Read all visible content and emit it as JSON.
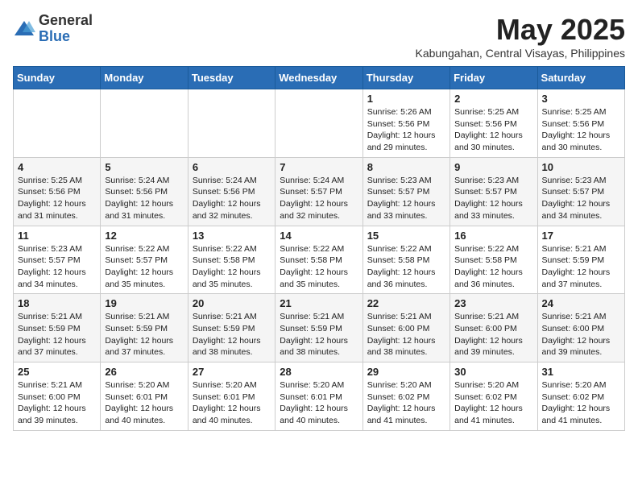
{
  "header": {
    "logo_general": "General",
    "logo_blue": "Blue",
    "month_title": "May 2025",
    "location": "Kabungahan, Central Visayas, Philippines"
  },
  "weekdays": [
    "Sunday",
    "Monday",
    "Tuesday",
    "Wednesday",
    "Thursday",
    "Friday",
    "Saturday"
  ],
  "weeks": [
    [
      {
        "day": "",
        "info": ""
      },
      {
        "day": "",
        "info": ""
      },
      {
        "day": "",
        "info": ""
      },
      {
        "day": "",
        "info": ""
      },
      {
        "day": "1",
        "info": "Sunrise: 5:26 AM\nSunset: 5:56 PM\nDaylight: 12 hours\nand 29 minutes."
      },
      {
        "day": "2",
        "info": "Sunrise: 5:25 AM\nSunset: 5:56 PM\nDaylight: 12 hours\nand 30 minutes."
      },
      {
        "day": "3",
        "info": "Sunrise: 5:25 AM\nSunset: 5:56 PM\nDaylight: 12 hours\nand 30 minutes."
      }
    ],
    [
      {
        "day": "4",
        "info": "Sunrise: 5:25 AM\nSunset: 5:56 PM\nDaylight: 12 hours\nand 31 minutes."
      },
      {
        "day": "5",
        "info": "Sunrise: 5:24 AM\nSunset: 5:56 PM\nDaylight: 12 hours\nand 31 minutes."
      },
      {
        "day": "6",
        "info": "Sunrise: 5:24 AM\nSunset: 5:56 PM\nDaylight: 12 hours\nand 32 minutes."
      },
      {
        "day": "7",
        "info": "Sunrise: 5:24 AM\nSunset: 5:57 PM\nDaylight: 12 hours\nand 32 minutes."
      },
      {
        "day": "8",
        "info": "Sunrise: 5:23 AM\nSunset: 5:57 PM\nDaylight: 12 hours\nand 33 minutes."
      },
      {
        "day": "9",
        "info": "Sunrise: 5:23 AM\nSunset: 5:57 PM\nDaylight: 12 hours\nand 33 minutes."
      },
      {
        "day": "10",
        "info": "Sunrise: 5:23 AM\nSunset: 5:57 PM\nDaylight: 12 hours\nand 34 minutes."
      }
    ],
    [
      {
        "day": "11",
        "info": "Sunrise: 5:23 AM\nSunset: 5:57 PM\nDaylight: 12 hours\nand 34 minutes."
      },
      {
        "day": "12",
        "info": "Sunrise: 5:22 AM\nSunset: 5:57 PM\nDaylight: 12 hours\nand 35 minutes."
      },
      {
        "day": "13",
        "info": "Sunrise: 5:22 AM\nSunset: 5:58 PM\nDaylight: 12 hours\nand 35 minutes."
      },
      {
        "day": "14",
        "info": "Sunrise: 5:22 AM\nSunset: 5:58 PM\nDaylight: 12 hours\nand 35 minutes."
      },
      {
        "day": "15",
        "info": "Sunrise: 5:22 AM\nSunset: 5:58 PM\nDaylight: 12 hours\nand 36 minutes."
      },
      {
        "day": "16",
        "info": "Sunrise: 5:22 AM\nSunset: 5:58 PM\nDaylight: 12 hours\nand 36 minutes."
      },
      {
        "day": "17",
        "info": "Sunrise: 5:21 AM\nSunset: 5:59 PM\nDaylight: 12 hours\nand 37 minutes."
      }
    ],
    [
      {
        "day": "18",
        "info": "Sunrise: 5:21 AM\nSunset: 5:59 PM\nDaylight: 12 hours\nand 37 minutes."
      },
      {
        "day": "19",
        "info": "Sunrise: 5:21 AM\nSunset: 5:59 PM\nDaylight: 12 hours\nand 37 minutes."
      },
      {
        "day": "20",
        "info": "Sunrise: 5:21 AM\nSunset: 5:59 PM\nDaylight: 12 hours\nand 38 minutes."
      },
      {
        "day": "21",
        "info": "Sunrise: 5:21 AM\nSunset: 5:59 PM\nDaylight: 12 hours\nand 38 minutes."
      },
      {
        "day": "22",
        "info": "Sunrise: 5:21 AM\nSunset: 6:00 PM\nDaylight: 12 hours\nand 38 minutes."
      },
      {
        "day": "23",
        "info": "Sunrise: 5:21 AM\nSunset: 6:00 PM\nDaylight: 12 hours\nand 39 minutes."
      },
      {
        "day": "24",
        "info": "Sunrise: 5:21 AM\nSunset: 6:00 PM\nDaylight: 12 hours\nand 39 minutes."
      }
    ],
    [
      {
        "day": "25",
        "info": "Sunrise: 5:21 AM\nSunset: 6:00 PM\nDaylight: 12 hours\nand 39 minutes."
      },
      {
        "day": "26",
        "info": "Sunrise: 5:20 AM\nSunset: 6:01 PM\nDaylight: 12 hours\nand 40 minutes."
      },
      {
        "day": "27",
        "info": "Sunrise: 5:20 AM\nSunset: 6:01 PM\nDaylight: 12 hours\nand 40 minutes."
      },
      {
        "day": "28",
        "info": "Sunrise: 5:20 AM\nSunset: 6:01 PM\nDaylight: 12 hours\nand 40 minutes."
      },
      {
        "day": "29",
        "info": "Sunrise: 5:20 AM\nSunset: 6:02 PM\nDaylight: 12 hours\nand 41 minutes."
      },
      {
        "day": "30",
        "info": "Sunrise: 5:20 AM\nSunset: 6:02 PM\nDaylight: 12 hours\nand 41 minutes."
      },
      {
        "day": "31",
        "info": "Sunrise: 5:20 AM\nSunset: 6:02 PM\nDaylight: 12 hours\nand 41 minutes."
      }
    ]
  ]
}
